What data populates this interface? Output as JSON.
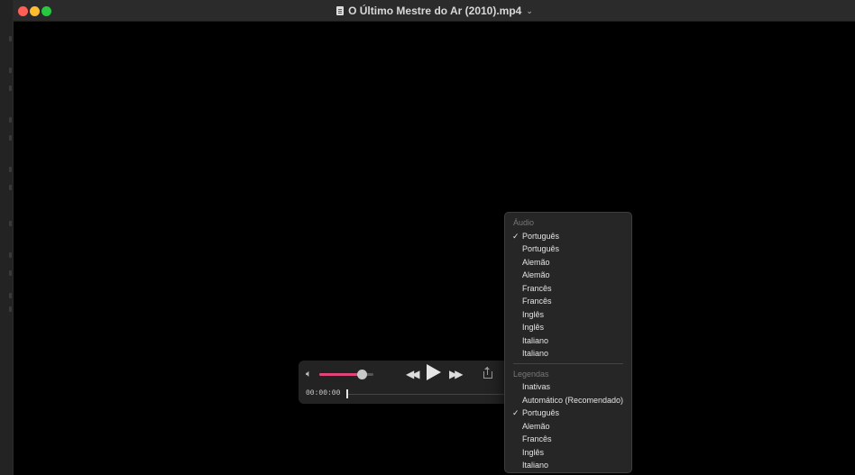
{
  "window": {
    "title": "O Último Mestre do Ar (2010).mp4",
    "title_chevron": "⌄"
  },
  "controls": {
    "volume_level": 0.78,
    "time": "00:00:00",
    "playback_progress": 0.0
  },
  "menu": {
    "audio_header": "Áudio",
    "audio_items": [
      {
        "label": "Português",
        "checked": true
      },
      {
        "label": "Português",
        "checked": false
      },
      {
        "label": "Alemão",
        "checked": false
      },
      {
        "label": "Alemão",
        "checked": false
      },
      {
        "label": "Francês",
        "checked": false
      },
      {
        "label": "Francês",
        "checked": false
      },
      {
        "label": "Inglês",
        "checked": false
      },
      {
        "label": "Inglês",
        "checked": false
      },
      {
        "label": "Italiano",
        "checked": false
      },
      {
        "label": "Italiano",
        "checked": false
      }
    ],
    "subtitles_header": "Legendas",
    "subtitle_items": [
      {
        "label": "Inativas",
        "checked": false
      },
      {
        "label": "Automático (Recomendado)",
        "checked": false
      },
      {
        "label": "Português",
        "checked": true
      },
      {
        "label": "Alemão",
        "checked": false
      },
      {
        "label": "Francês",
        "checked": false
      },
      {
        "label": "Inglês",
        "checked": false
      },
      {
        "label": "Italiano",
        "checked": false
      }
    ],
    "check_glyph": "✓"
  },
  "colors": {
    "volume_fill": "#e0457a",
    "close": "#fe5f57",
    "minimize": "#febc2e",
    "maximize": "#28c840"
  }
}
